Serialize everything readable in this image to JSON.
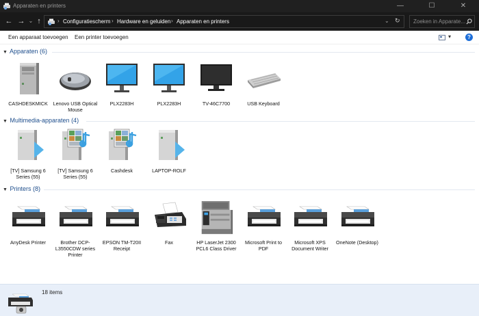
{
  "window": {
    "title": "Apparaten en printers",
    "minimize_glyph": "—",
    "maximize_glyph": "☐",
    "close_glyph": "✕"
  },
  "nav": {
    "back_glyph": "←",
    "forward_glyph": "→",
    "recent_glyph": "⌄",
    "up_glyph": "↑",
    "breadcrumb": [
      "Configuratiescherm",
      "Hardware en geluiden",
      "Apparaten en printers"
    ],
    "sep_glyph": "›",
    "dropdown_glyph": "⌄",
    "refresh_glyph": "↻",
    "search_placeholder": "Zoeken in Apparate..."
  },
  "commands": {
    "add_device": "Een apparaat toevoegen",
    "add_printer": "Een printer toevoegen",
    "view_glyph": "▾",
    "help_glyph": "?"
  },
  "groups": {
    "apparaten": {
      "header": "Apparaten (6)",
      "items": [
        {
          "label": "CASHDESKMICK",
          "icon": "computer-tower-icon"
        },
        {
          "label": "Lenovo USB Optical Mouse",
          "icon": "mouse-icon"
        },
        {
          "label": "PLX2283H",
          "icon": "monitor-icon"
        },
        {
          "label": "PLX2283H",
          "icon": "monitor-icon"
        },
        {
          "label": "TV-46C7700",
          "icon": "tv-icon"
        },
        {
          "label": "USB Keyboard",
          "icon": "keyboard-icon"
        }
      ]
    },
    "multimedia": {
      "header": "Multimedia-apparaten (4)",
      "items": [
        {
          "label": "[TV] Samsung 6 Series (55)",
          "icon": "media-renderer-icon"
        },
        {
          "label": "[TV] Samsung 6 Series (55)",
          "icon": "media-server-icon"
        },
        {
          "label": "Cashdesk",
          "icon": "media-server-icon"
        },
        {
          "label": "LAPTOP-ROLF",
          "icon": "media-renderer-icon"
        }
      ]
    },
    "printers": {
      "header": "Printers (8)",
      "items": [
        {
          "label": "AnyDesk Printer",
          "icon": "printer-icon"
        },
        {
          "label": "Brother DCP-L3550CDW series Printer",
          "icon": "printer-icon"
        },
        {
          "label": "EPSON TM-T20II Receipt",
          "icon": "printer-icon"
        },
        {
          "label": "Fax",
          "icon": "fax-icon"
        },
        {
          "label": "HP LaserJet 2300 PCL6 Class Driver",
          "icon": "laser-printer-icon"
        },
        {
          "label": "Microsoft Print to PDF",
          "icon": "printer-icon"
        },
        {
          "label": "Microsoft XPS Document Writer",
          "icon": "printer-icon"
        },
        {
          "label": "OneNote (Desktop)",
          "icon": "printer-icon"
        }
      ]
    }
  },
  "details": {
    "count": "18 items",
    "icon": "printer-camera-icon"
  },
  "colors": {
    "group_header": "#1e4e8c",
    "details_bg": "#e8eff9",
    "titlebar_bg": "#202020"
  }
}
